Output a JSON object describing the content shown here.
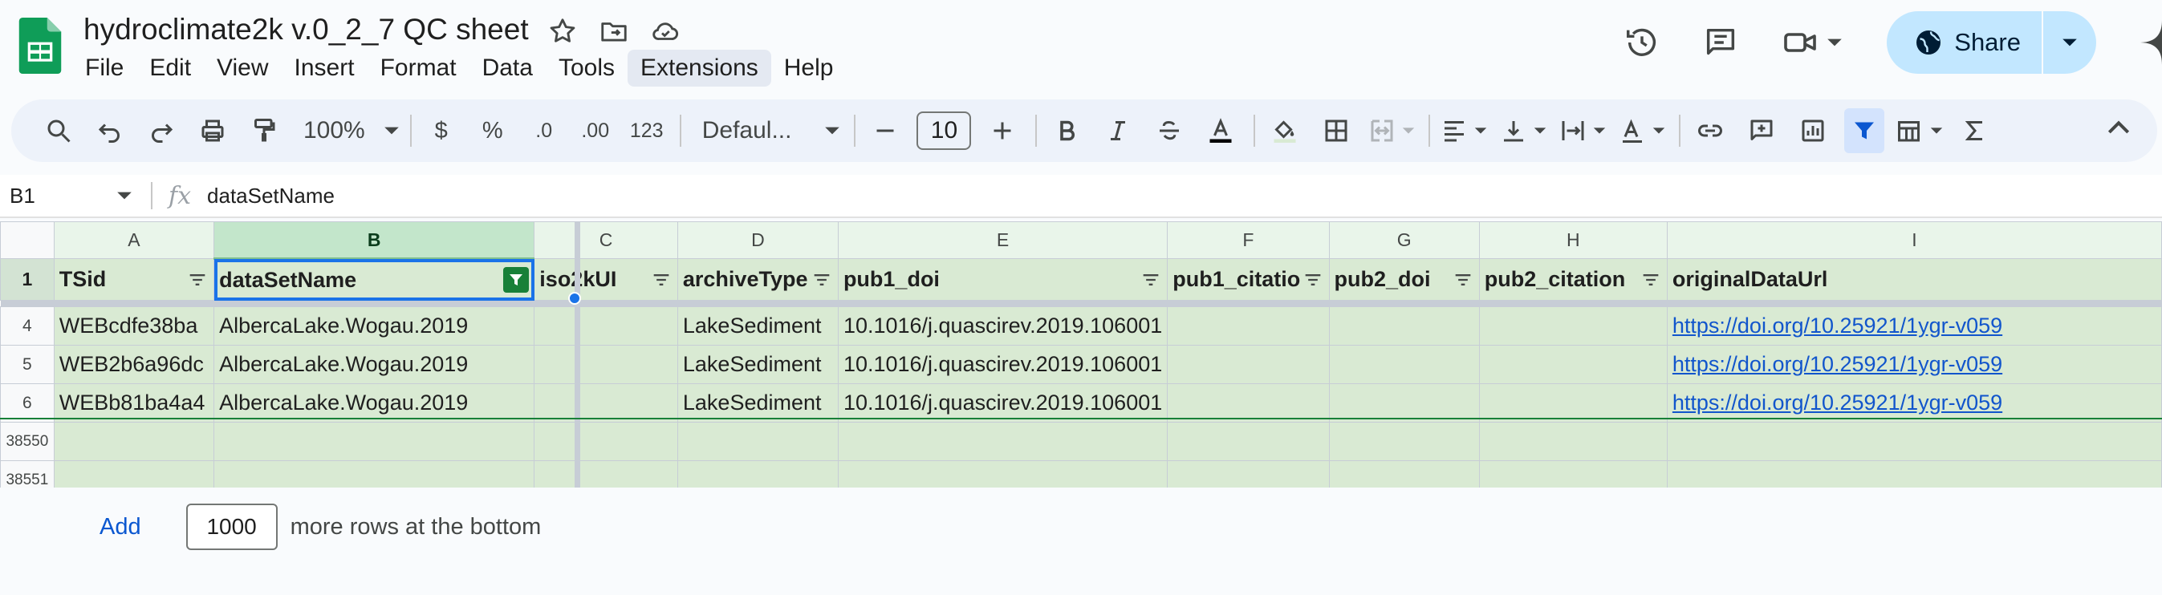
{
  "document": {
    "title": "hydroclimate2k v.0_2_7 QC sheet"
  },
  "menu": [
    "File",
    "Edit",
    "View",
    "Insert",
    "Format",
    "Data",
    "Tools",
    "Extensions",
    "Help"
  ],
  "active_menu": "Extensions",
  "share": {
    "label": "Share"
  },
  "toolbar": {
    "zoom": "100%",
    "currency": "$",
    "percent": "%",
    "dec_decrease": ".0",
    "dec_increase": ".00",
    "number_format": "123",
    "font_family": "Defaul...",
    "font_size": "10"
  },
  "formula_bar": {
    "cell_ref": "B1",
    "fx": "fx",
    "content": "dataSetName"
  },
  "grid": {
    "column_letters": [
      "A",
      "B",
      "C",
      "D",
      "E",
      "F",
      "G",
      "H",
      "I"
    ],
    "header_row_number": "1",
    "headers": [
      "TSid",
      "dataSetName",
      "iso2kUI",
      "archiveType",
      "pub1_doi",
      "pub1_citatio",
      "pub2_doi",
      "pub2_citation",
      "originalDataUrl"
    ],
    "rows": [
      {
        "num": "4",
        "cells": [
          "WEBcdfe38ba",
          "AlbercaLake.Wogau.2019",
          "",
          "LakeSediment",
          "10.1016/j.quascirev.2019.106001",
          "",
          "",
          "",
          "https://doi.org/10.25921/1ygr-v059"
        ]
      },
      {
        "num": "5",
        "cells": [
          "WEB2b6a96dc",
          "AlbercaLake.Wogau.2019",
          "",
          "LakeSediment",
          "10.1016/j.quascirev.2019.106001",
          "",
          "",
          "",
          "https://doi.org/10.25921/1ygr-v059"
        ]
      },
      {
        "num": "6",
        "cells": [
          "WEBb81ba4a4",
          "AlbercaLake.Wogau.2019",
          "",
          "LakeSediment",
          "10.1016/j.quascirev.2019.106001",
          "",
          "",
          "",
          "https://doi.org/10.25921/1ygr-v059"
        ]
      }
    ],
    "empty_rows": [
      "38550",
      "38551"
    ]
  },
  "add_rows": {
    "button": "Add",
    "count": "1000",
    "label": "more rows at the bottom"
  },
  "colors": {
    "accent": "#1a73e8",
    "share_bg": "#c2e7ff",
    "filter_green": "#188038",
    "band_green": "#d9ead3",
    "link": "#1155cc"
  }
}
